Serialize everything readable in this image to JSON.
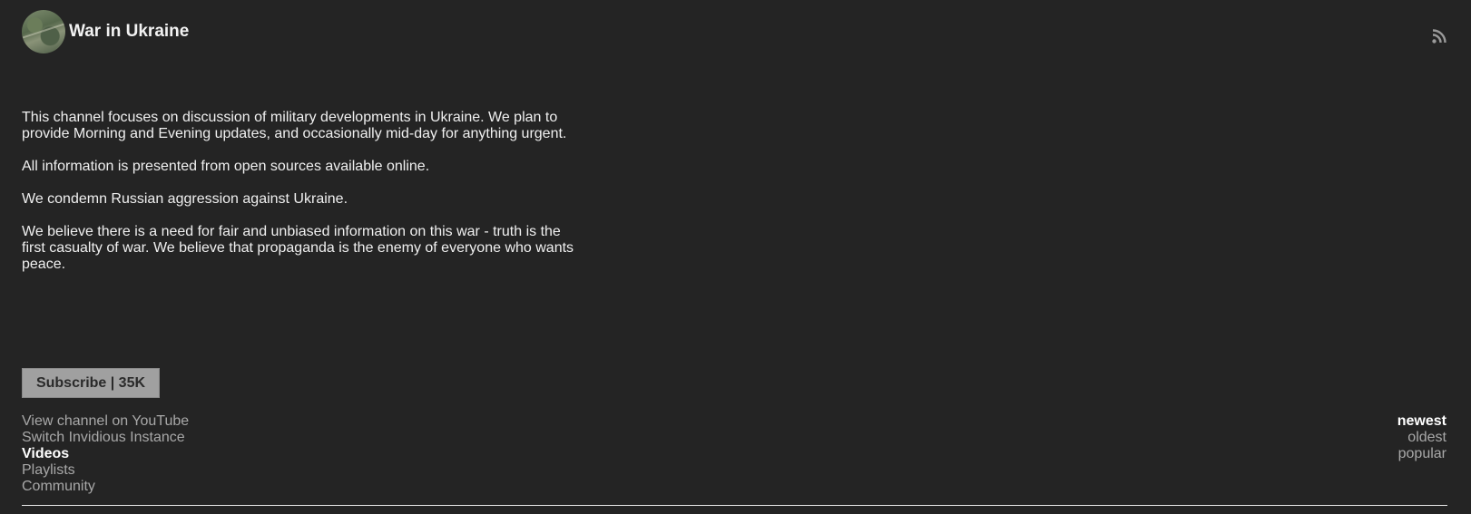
{
  "channel": {
    "name": "War in Ukraine"
  },
  "about": {
    "paragraphs": [
      "This channel focuses on discussion of military developments in Ukraine. We plan to provide Morning and Evening updates, and occasionally mid-day for anything urgent.",
      "All information is presented from open sources available online.",
      "We condemn Russian aggression against Ukraine.",
      "We believe there is a need for fair and unbiased information on this war - truth is the first casualty of war. We believe that propaganda is the enemy of everyone who wants peace."
    ]
  },
  "subscribe": {
    "label": "Subscribe | 35K"
  },
  "links": {
    "youtube": "View channel on YouTube",
    "switch_instance": "Switch Invidious Instance",
    "videos": "Videos",
    "playlists": "Playlists",
    "community": "Community"
  },
  "sort": {
    "newest": "newest",
    "oldest": "oldest",
    "popular": "popular"
  },
  "icons": {
    "rss": "rss-icon",
    "avatar": "channel-avatar"
  },
  "colors": {
    "background": "#242424",
    "text": "#f0f0f0",
    "link": "#a8a8a8",
    "button": "#a0a0a0"
  }
}
